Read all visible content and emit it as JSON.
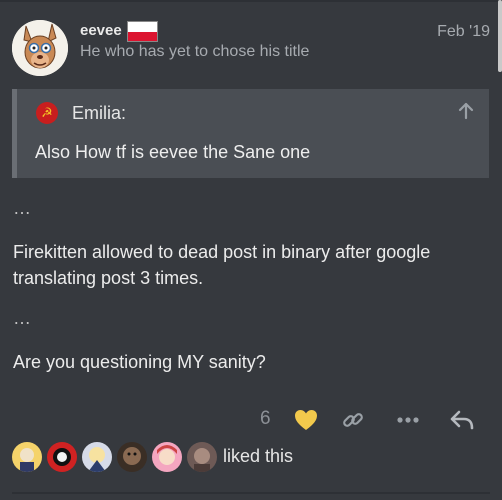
{
  "post": {
    "username": "eevee",
    "user_title": "He who has yet to chose his title",
    "date": "Feb '19",
    "avatar": "cartoon-kangaroo-avatar",
    "flag": "poland-flag"
  },
  "quote": {
    "author": "Emilia:",
    "text": "Also How tf is eevee the Sane one",
    "avatar": "hammer-sickle-avatar"
  },
  "body": {
    "ellipsis_1": "…",
    "paragraph_1": "Firekitten allowed to dead post in binary after google translating post 3 times.",
    "ellipsis_2": "…",
    "paragraph_2": "Are you questioning MY sanity?"
  },
  "actions": {
    "like_count": "6",
    "liked": true
  },
  "likers": {
    "text": "liked this",
    "avatars": [
      "liker-1",
      "liker-2",
      "liker-3",
      "liker-4",
      "liker-5",
      "liker-6"
    ]
  },
  "colors": {
    "background": "#36393e",
    "quote_bg": "#4a4e54",
    "heart": "#f2c94c",
    "muted": "#a7abb0"
  }
}
